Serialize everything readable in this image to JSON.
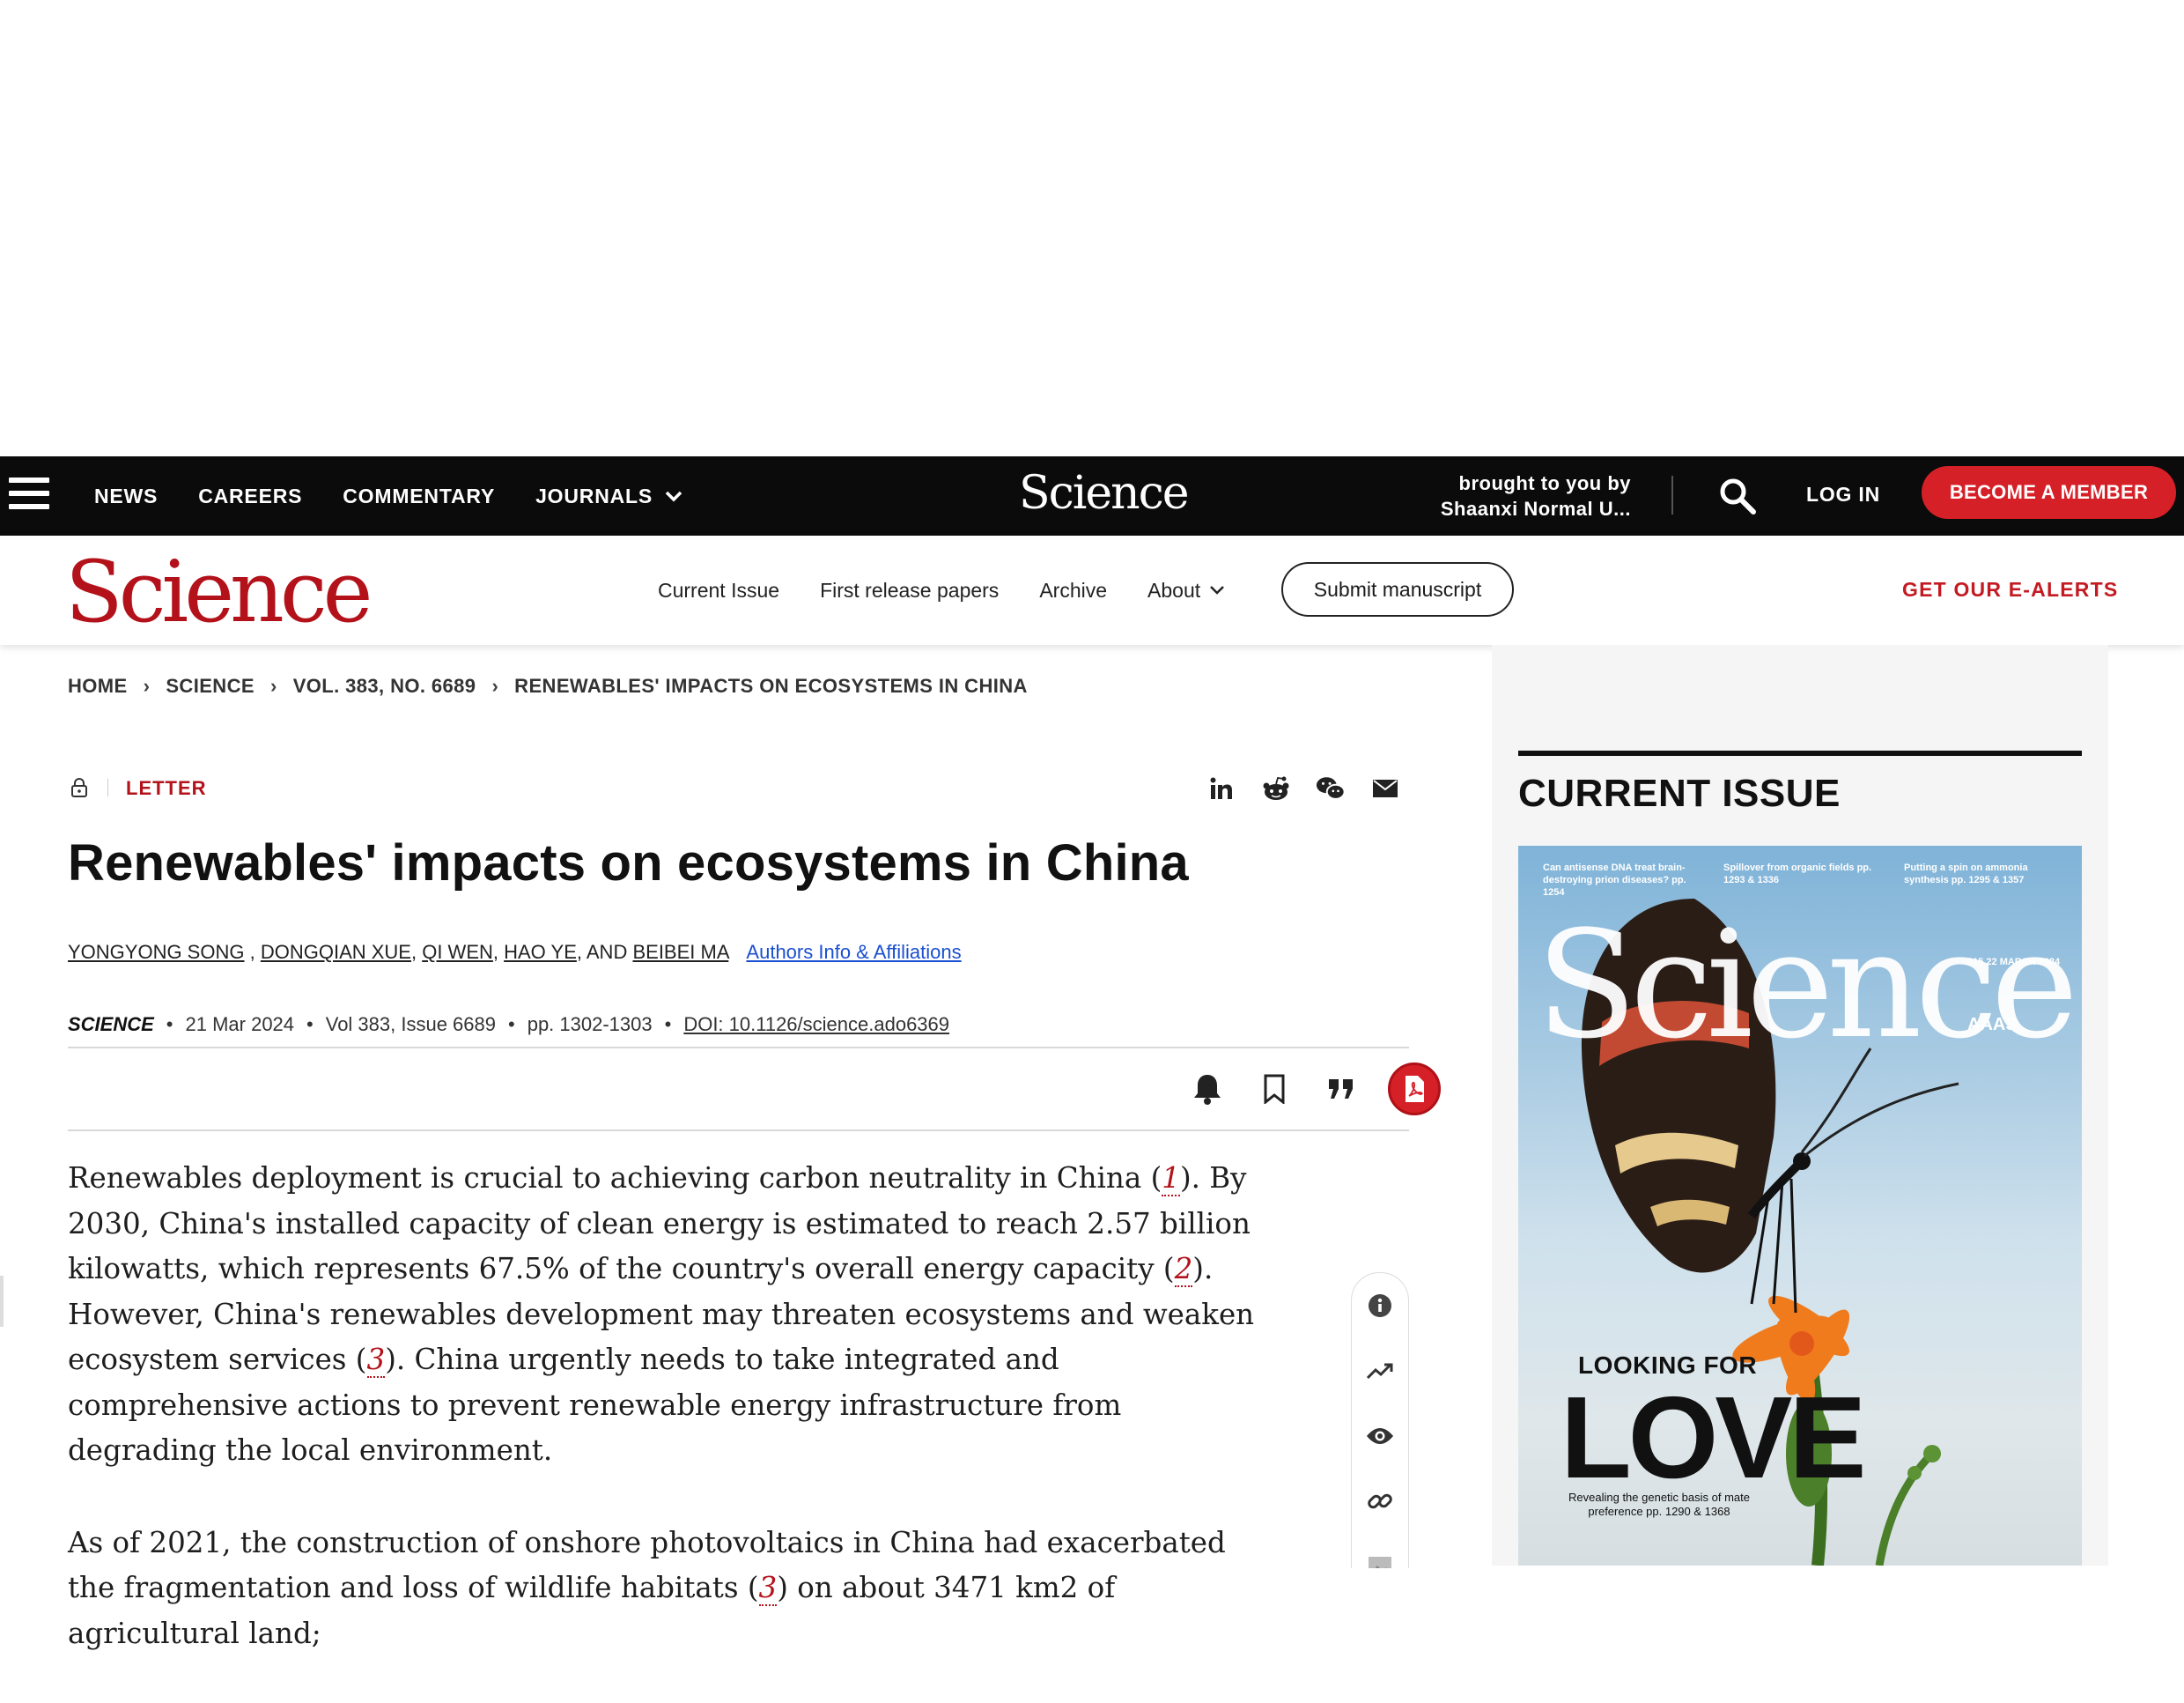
{
  "topbar": {
    "nav": [
      {
        "label": "NEWS"
      },
      {
        "label": "CAREERS"
      },
      {
        "label": "COMMENTARY"
      },
      {
        "label": "JOURNALS"
      }
    ],
    "logo": "Science",
    "brought_line1": "brought to you by",
    "brought_line2": "Shaanxi Normal U...",
    "login": "LOG IN",
    "member": "BECOME A MEMBER",
    "accent_color": "#d62027"
  },
  "subheader": {
    "logo": "Science",
    "nav": [
      {
        "label": "Current Issue"
      },
      {
        "label": "First release papers"
      },
      {
        "label": "Archive"
      },
      {
        "label": "About"
      }
    ],
    "submit": "Submit manuscript",
    "ealerts": "GET OUR E-ALERTS",
    "brand_color": "#b3121b"
  },
  "breadcrumb": [
    "HOME",
    "SCIENCE",
    "VOL. 383, NO. 6689",
    "RENEWABLES' IMPACTS ON ECOSYSTEMS IN CHINA"
  ],
  "article": {
    "type": "LETTER",
    "title": "Renewables' impacts on ecosystems in China",
    "authors": [
      "YONGYONG SONG",
      "DONGQIAN XUE",
      "QI WEN",
      "HAO YE",
      "BEIBEI MA"
    ],
    "and_label": ", AND",
    "affiliations_link": "Authors Info & Affiliations",
    "journal": "SCIENCE",
    "date": "21 Mar 2024",
    "volume": "Vol 383, Issue 6689",
    "pages": "pp. 1302-1303",
    "doi": "DOI: 10.1126/science.ado6369",
    "share_icons": [
      "linkedin-icon",
      "reddit-icon",
      "wechat-icon",
      "email-icon"
    ],
    "tool_icons": [
      "bell-icon",
      "bookmark-icon",
      "quote-icon",
      "pdf-icon"
    ],
    "side_tools": [
      "info-icon",
      "trending-icon",
      "eye-icon",
      "link-icon",
      "image-icon"
    ]
  },
  "body": {
    "p1_a": "Renewables deployment is crucial to achieving carbon neutrality in China (",
    "ref1": "1",
    "p1_b": "). By 2030, China's installed capacity of clean energy is estimated to reach 2.57 billion kilowatts, which represents 67.5% of the country's overall energy capacity (",
    "ref2": "2",
    "p1_c": "). However, China's renewables development may threaten ecosystems and weaken ecosystem services (",
    "ref3": "3",
    "p1_d": "). China urgently needs to take integrated and comprehensive actions to prevent renewable energy infrastructure from degrading the local environment.",
    "p2_a": "As of 2021, the construction of onshore photovoltaics in China had exacerbated the fragmentation and loss of wildlife habitats (",
    "ref4": "3",
    "p2_b": ") on about 3471 km2 of agricultural land;"
  },
  "current_issue": {
    "heading": "CURRENT ISSUE",
    "cover": {
      "teasers": [
        "Can antisense DNA treat brain-destroying prion diseases? pp. 1254",
        "Spillover from organic fields pp. 1293 & 1336",
        "Putting a spin on ammonia synthesis pp. 1295 & 1357"
      ],
      "logo": "Science",
      "price_date": "$15 22 MARCH 2024",
      "publisher": "AAAS",
      "kicker": "LOOKING FOR",
      "headline": "LOVE",
      "subline": "Revealing the genetic basis of mate preference pp. 1290 & 1368"
    }
  }
}
